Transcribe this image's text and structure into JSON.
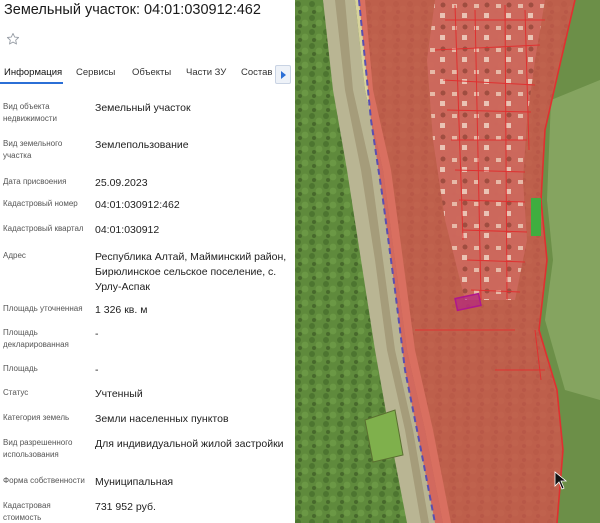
{
  "title": "Земельный участок: 04:01:030912:462",
  "favorite_icon": "star-icon",
  "tabs": [
    {
      "label": "Информация",
      "active": true
    },
    {
      "label": "Сервисы"
    },
    {
      "label": "Объекты"
    },
    {
      "label": "Части ЗУ"
    },
    {
      "label": "Состав"
    }
  ],
  "tabs_next_icon": "chevron-right-icon",
  "fields": [
    {
      "label": "Вид объекта недвижимости",
      "value": "Земельный участок"
    },
    {
      "label": "Вид земельного участка",
      "value": "Землепользование"
    },
    {
      "label": "Дата присвоения",
      "value": "25.09.2023"
    },
    {
      "label": "Кадастровый номер",
      "value": "04:01:030912:462"
    },
    {
      "label": "Кадастровый квартал",
      "value": "04:01:030912"
    },
    {
      "label": "Адрес",
      "value": "Республика Алтай, Майминский район, Бирюлинское сельское поселение, с. Урлу-Аспак"
    },
    {
      "label": "Площадь уточненная",
      "value": "1 326 кв. м"
    },
    {
      "label": "Площадь декларированная",
      "value": "-"
    },
    {
      "label": "Площадь",
      "value": "-"
    },
    {
      "label": "Статус",
      "value": "Учтенный"
    },
    {
      "label": "Категория земель",
      "value": "Земли населенных пунктов"
    },
    {
      "label": "Вид разрешенного использования",
      "value": "Для индивидуальной жилой застройки"
    },
    {
      "label": "Форма собственности",
      "value": "Муниципальная"
    },
    {
      "label": "Кадастровая стоимость",
      "value": "731 952 руб."
    }
  ],
  "colors": {
    "accent": "#2b6fd6",
    "zone_fill": "#d9534f",
    "parcel_border": "#e03030",
    "selected_parcel": "#b0168e",
    "forest": "#5f8a3c",
    "river_bank": "#b9b593"
  }
}
